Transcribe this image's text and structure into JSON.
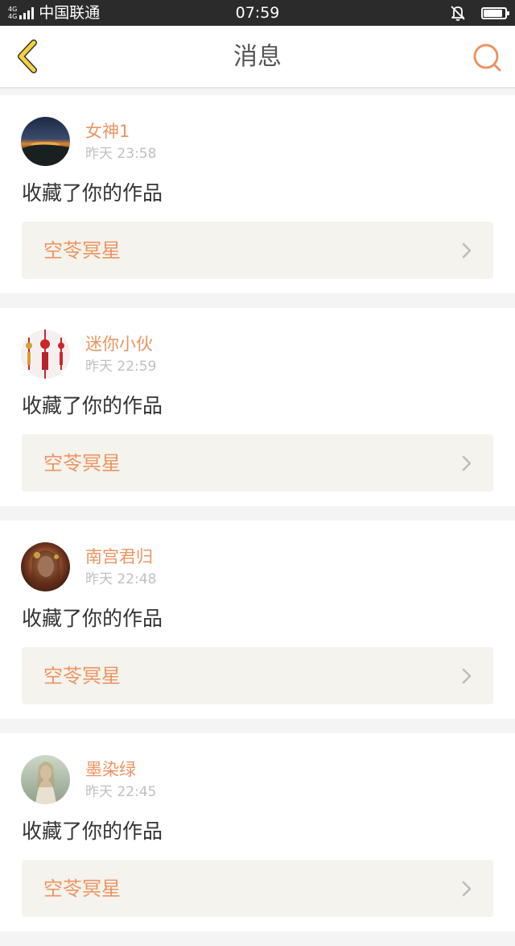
{
  "status_bar": {
    "network_type_top": "4G",
    "network_type_bottom": "4G",
    "carrier": "中国联通",
    "time": "07:59",
    "battery_level": 0.95
  },
  "nav": {
    "title": "消息",
    "back_icon": "chevron-left-icon",
    "search_icon": "search-icon"
  },
  "colors": {
    "accent": "#ec9461",
    "back_arrow": "#f4d23c",
    "card_link_bg": "#f4f3ed"
  },
  "messages": [
    {
      "user": "女神1",
      "time": "昨天 23:58",
      "action": "收藏了你的作品",
      "work_title": "空苓冥星"
    },
    {
      "user": "迷你小伙",
      "time": "昨天 22:59",
      "action": "收藏了你的作品",
      "work_title": "空苓冥星"
    },
    {
      "user": "南宫君归",
      "time": "昨天 22:48",
      "action": "收藏了你的作品",
      "work_title": "空苓冥星"
    },
    {
      "user": "墨染绿",
      "time": "昨天 22:45",
      "action": "收藏了你的作品",
      "work_title": "空苓冥星"
    }
  ]
}
